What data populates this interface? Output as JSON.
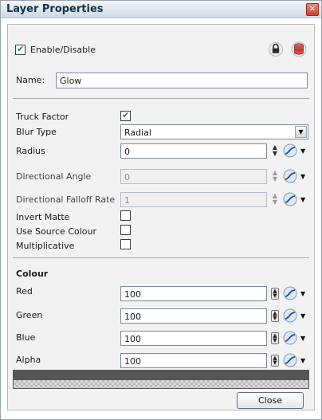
{
  "window": {
    "title": "Layer Properties"
  },
  "enable": {
    "label": "Enable/Disable",
    "checked": true
  },
  "name": {
    "label": "Name:",
    "value": "Glow"
  },
  "truck_factor": {
    "label": "Truck Factor",
    "checked": true
  },
  "blur_type": {
    "label": "Blur Type",
    "value": "Radial"
  },
  "radius": {
    "label": "Radius",
    "value": "0"
  },
  "directional_angle": {
    "label": "Directional Angle",
    "value": "0"
  },
  "directional_falloff": {
    "label": "Directional Falloff Rate",
    "value": "1"
  },
  "invert_matte": {
    "label": "Invert Matte",
    "checked": false
  },
  "use_source_colour": {
    "label": "Use Source Colour",
    "checked": false
  },
  "multiplicative": {
    "label": "Multiplicative",
    "checked": false
  },
  "colour": {
    "heading": "Colour",
    "red": {
      "label": "Red",
      "value": "100"
    },
    "green": {
      "label": "Green",
      "value": "100"
    },
    "blue": {
      "label": "Blue",
      "value": "100"
    },
    "alpha": {
      "label": "Alpha",
      "value": "100"
    },
    "swatch_color": "#555555"
  },
  "close_button": "Close",
  "icons": [
    "lock-icon",
    "database-icon",
    "function-curve-icon",
    "dropdown-arrow-icon",
    "spin-arrows-icon",
    "close-x-icon"
  ]
}
